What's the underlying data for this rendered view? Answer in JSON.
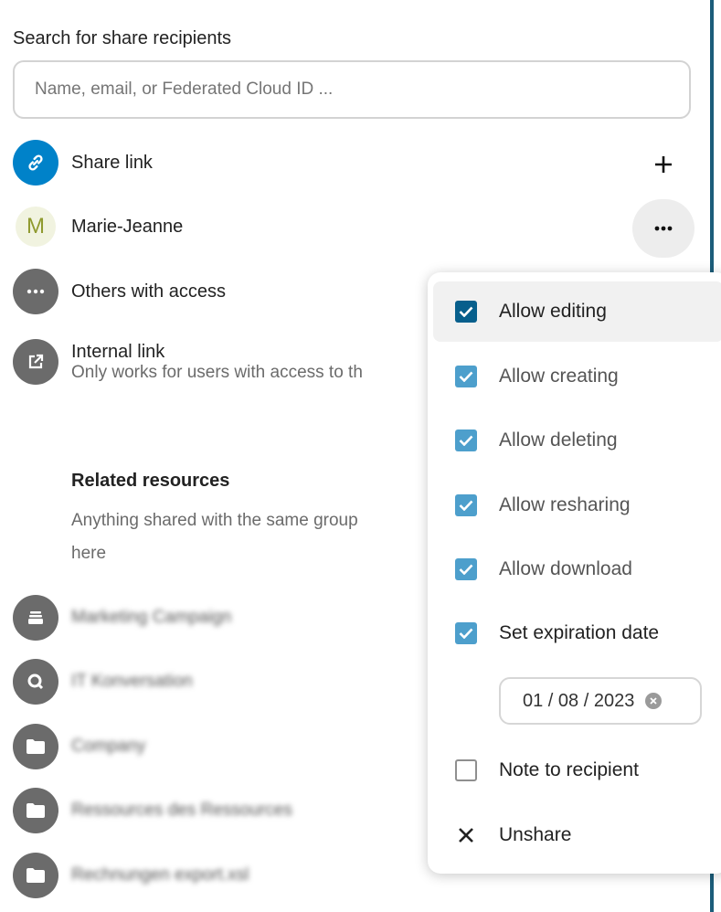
{
  "search": {
    "label": "Search for share recipients",
    "placeholder": "Name, email, or Federated Cloud ID ..."
  },
  "shares": {
    "share_link": {
      "label": "Share link",
      "icon": "link-icon",
      "add_icon": "plus-icon"
    },
    "user": {
      "initial": "M",
      "name": "Marie-Jeanne",
      "more_icon": "more-icon"
    },
    "others": {
      "label": "Others with access",
      "icon": "more-icon"
    },
    "internal_link": {
      "title": "Internal link",
      "subtitle": "Only works for users with access to th",
      "icon": "external-link-icon"
    }
  },
  "related": {
    "title": "Related resources",
    "description": "Anything shared with the same group",
    "description_line2": "here",
    "items": [
      {
        "icon": "deck-icon",
        "label": "Marketing Campaign"
      },
      {
        "icon": "talk-icon",
        "label": "IT Konversation"
      },
      {
        "icon": "folder-icon",
        "label": "Company"
      },
      {
        "icon": "folder-icon",
        "label": "Ressources des Ressources"
      },
      {
        "icon": "folder-icon",
        "label": "Rechnungen export.xsl"
      }
    ]
  },
  "menu": {
    "items": [
      {
        "label": "Allow editing",
        "checked": true
      },
      {
        "label": "Allow creating",
        "checked": true
      },
      {
        "label": "Allow deleting",
        "checked": true
      },
      {
        "label": "Allow resharing",
        "checked": true
      },
      {
        "label": "Allow download",
        "checked": true
      },
      {
        "label": "Set expiration date",
        "checked": true
      }
    ],
    "expiration_date": "01 / 08 / 2023",
    "note": {
      "label": "Note to recipient",
      "checked": false
    },
    "unshare": {
      "label": "Unshare",
      "icon": "close-icon"
    }
  },
  "colors": {
    "primary": "#0082c9",
    "checkbox_active": "#075f8c",
    "checkbox": "#4d9fcc",
    "icon_gray": "#6b6b6b"
  }
}
